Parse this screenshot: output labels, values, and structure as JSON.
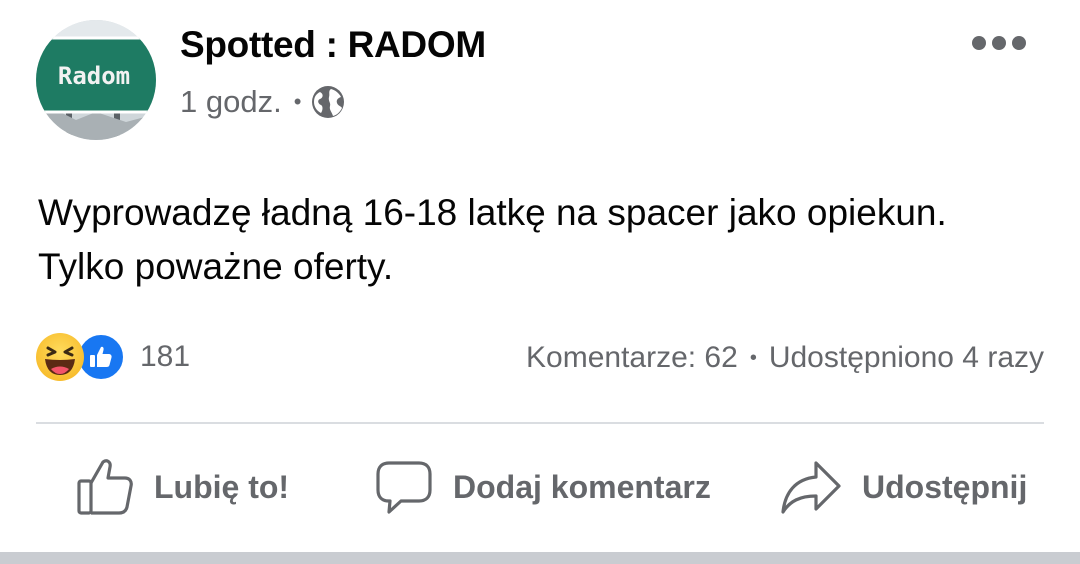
{
  "post": {
    "page_name": "Spotted : RADOM",
    "avatar_sign_text": "Radom",
    "time": "1 godz.",
    "audience_icon": "globe-icon",
    "text_lines": [
      "Wyprowadzę ładną 16-18 latkę na spacer jako opiekun.",
      "Tylko poważne oferty."
    ],
    "reactions": {
      "icons": [
        "haha-emoji",
        "like-emoji"
      ],
      "count": "181"
    },
    "comments_label": "Komentarze: 62",
    "shares_label": "Udostępniono 4 razy",
    "separator": "•"
  },
  "actions": {
    "like_label": "Lubię to!",
    "comment_label": "Dodaj komentarz",
    "share_label": "Udostępnij"
  },
  "colors": {
    "text": "#050505",
    "secondary": "#65676b",
    "brand_blue": "#1877f2",
    "divider": "#dadde1"
  }
}
